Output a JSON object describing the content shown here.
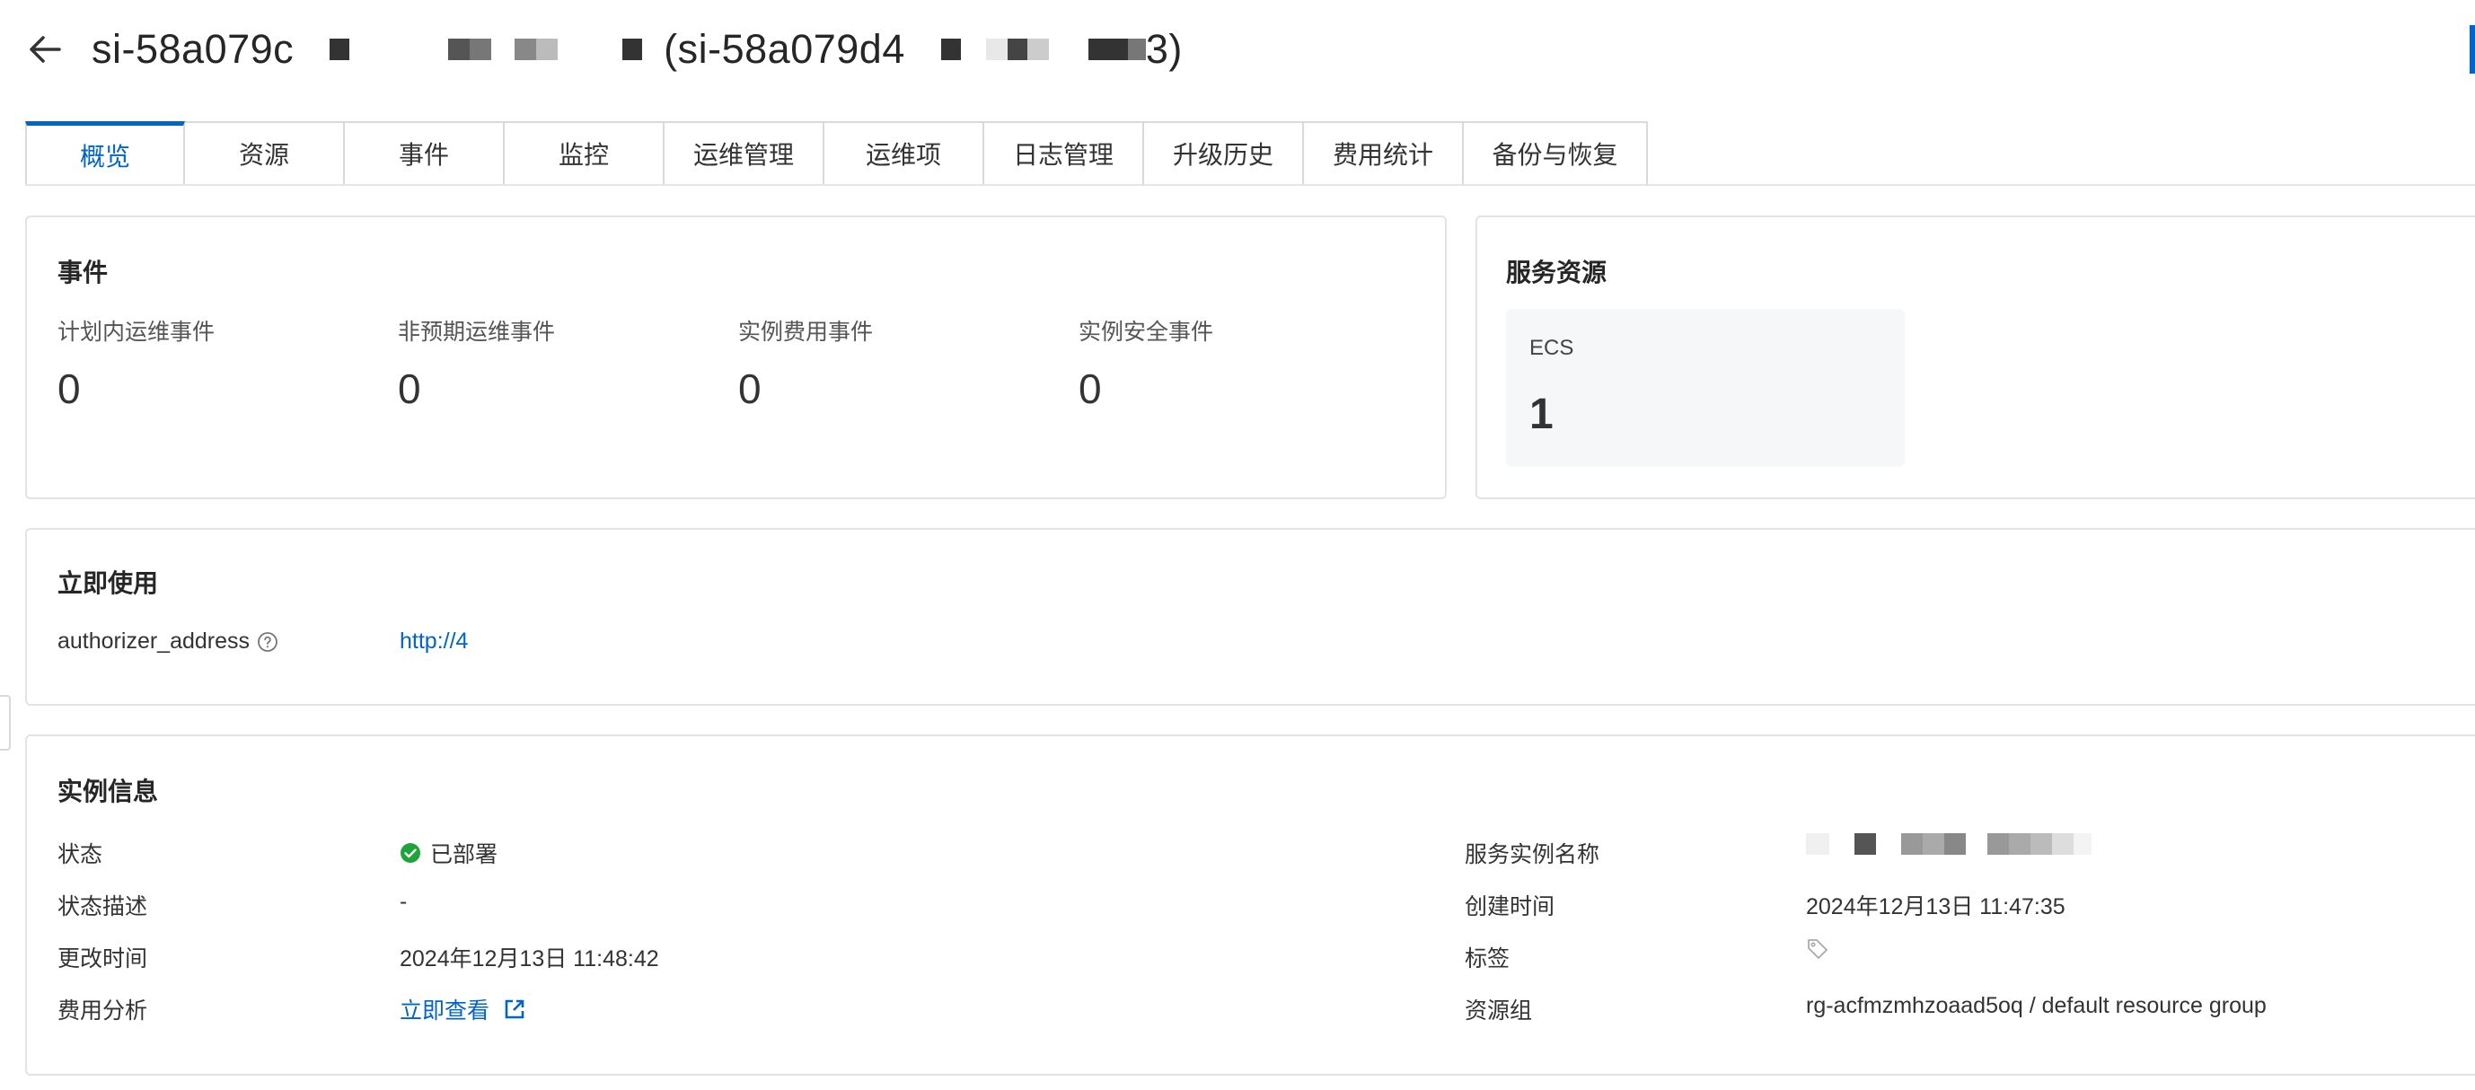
{
  "header": {
    "title_part1": "si-58a079c",
    "title_part2": "(si-58a079d4",
    "title_part3": "3)",
    "back_icon": "arrow-left-icon"
  },
  "tabs": [
    {
      "label": "概览",
      "active": true
    },
    {
      "label": "资源"
    },
    {
      "label": "事件"
    },
    {
      "label": "监控"
    },
    {
      "label": "运维管理"
    },
    {
      "label": "运维项"
    },
    {
      "label": "日志管理"
    },
    {
      "label": "升级历史"
    },
    {
      "label": "费用统计"
    },
    {
      "label": "备份与恢复"
    }
  ],
  "events": {
    "title": "事件",
    "items": [
      {
        "label": "计划内运维事件",
        "value": "0"
      },
      {
        "label": "非预期运维事件",
        "value": "0"
      },
      {
        "label": "实例费用事件",
        "value": "0"
      },
      {
        "label": "实例安全事件",
        "value": "0"
      }
    ]
  },
  "service_resources": {
    "title": "服务资源",
    "ecs_label": "ECS",
    "ecs_count": "1"
  },
  "use_now": {
    "title": "立即使用",
    "key": "authorizer_address",
    "value": "http://4",
    "help_icon": "question-circle-icon"
  },
  "instance_info": {
    "title": "实例信息",
    "left": {
      "status_label": "状态",
      "status_value": "已部署",
      "status_desc_label": "状态描述",
      "status_desc_value": "-",
      "modified_label": "更改时间",
      "modified_value": "2024年12月13日 11:48:42",
      "cost_label": "费用分析",
      "cost_value": "立即查看"
    },
    "right": {
      "name_label": "服务实例名称",
      "created_label": "创建时间",
      "created_value": "2024年12月13日 11:47:35",
      "tags_label": "标签",
      "rg_label": "资源组",
      "rg_value": "rg-acfmzmhzoaad5oq / default resource group"
    }
  },
  "colors": {
    "accent": "#0064c8",
    "success": "#1fa33b",
    "border": "#e3e3e3"
  }
}
